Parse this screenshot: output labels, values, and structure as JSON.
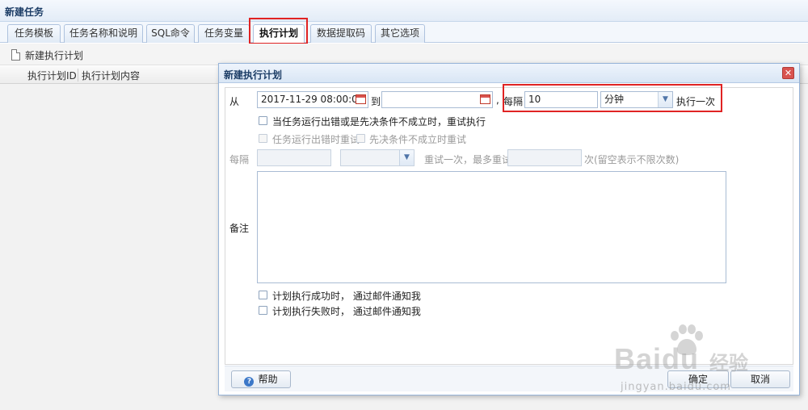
{
  "window": {
    "title": "新建任务"
  },
  "tabs": [
    {
      "label": "任务模板"
    },
    {
      "label": "任务名称和说明"
    },
    {
      "label": "SQL命令"
    },
    {
      "label": "任务变量"
    },
    {
      "label": "执行计划",
      "active": true
    },
    {
      "label": "数据提取码"
    },
    {
      "label": "其它选项"
    }
  ],
  "toolbar": {
    "new_plan_label": "新建执行计划"
  },
  "grid": {
    "columns": [
      "执行计划ID",
      "执行计划内容"
    ]
  },
  "dialog": {
    "title": "新建执行计划",
    "from_label": "从",
    "from_value": "2017-11-29 08:00:00",
    "to_label": "到",
    "to_value": "",
    "comma": ",",
    "every_label": "每隔",
    "interval_value": "10",
    "unit_value": "分钟",
    "run_once_label": "执行一次",
    "retry_main_label": "当任务运行出错或是先决条件不成立时，重试执行",
    "retry_on_error_label": "任务运行出错时重试",
    "retry_on_precondition_label": "先决条件不成立时重试",
    "retry_every_label": "每隔",
    "retry_interval_value": "",
    "retry_unit_value": "",
    "retry_once_label": "重试一次，最多重试",
    "retry_max_value": "",
    "retry_count_hint": "次(留空表示不限次数)",
    "remark_label": "备注",
    "remark_value": "",
    "notify_success_label": "计划执行成功时， 通过邮件通知我",
    "notify_fail_label": "计划执行失败时， 通过邮件通知我",
    "help_label": "帮助",
    "ok_label": "确定",
    "cancel_label": "取消"
  },
  "watermark": {
    "brand": "Baidu",
    "brand_cn": "经验",
    "url": "jingyan.baidu.com"
  },
  "colors": {
    "highlight": "#e02323",
    "title_blue": "#1c3d66",
    "border_blue": "#97b4d8"
  }
}
